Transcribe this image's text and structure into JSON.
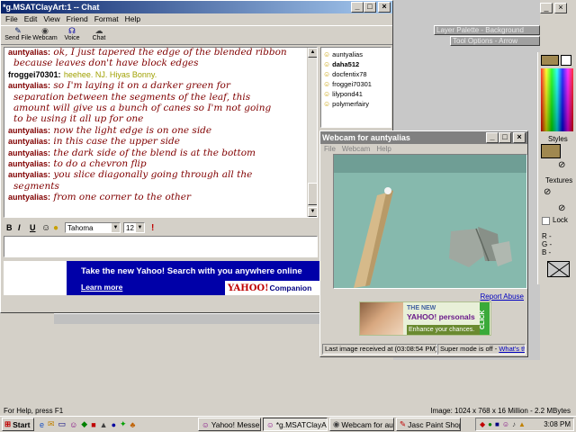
{
  "chat": {
    "title": "*g.MSATClayArt:1 -- Chat",
    "menu": [
      "File",
      "Edit",
      "View",
      "Friend",
      "Format",
      "Help"
    ],
    "toolbar": [
      "Send File",
      "Webcam",
      "Voice",
      "Chat"
    ],
    "messages": [
      {
        "nick": "auntyalias:",
        "text": "ok, I just tapered the edge of the blended ribbon"
      },
      {
        "nick": "",
        "text": "because leaves don't have block edges"
      },
      {
        "nick": "froggei70301:",
        "text": "heehee. NJ. Hiyas Bonny."
      },
      {
        "nick": "auntyalias:",
        "text": "so I'm laying it on a darker green for"
      },
      {
        "nick": "",
        "text": "separation between the segments of the leaf, this"
      },
      {
        "nick": "",
        "text": "amount will give us a bunch of canes so I'm not going"
      },
      {
        "nick": "",
        "text": "to be using it all up for one"
      },
      {
        "nick": "auntyalias:",
        "text": "now the light edge is on one side"
      },
      {
        "nick": "auntyalias:",
        "text": "in this case the upper side"
      },
      {
        "nick": "auntyalias:",
        "text": "the dark side of the blend is at the bottom"
      },
      {
        "nick": "auntyalias:",
        "text": "to do a chevron flip"
      },
      {
        "nick": "auntyalias:",
        "text": "you slice diagonally going through all the"
      },
      {
        "nick": "",
        "text": "segments"
      },
      {
        "nick": "auntyalias:",
        "text": "from one corner to the other"
      }
    ],
    "format": {
      "bold": "B",
      "italic": "I",
      "underline": "U",
      "font": "Tahoma",
      "size": "12"
    },
    "users": [
      "auntyalias",
      "daha512",
      "docfentix78",
      "froggei70301",
      "lilypond41",
      "polymerfairy"
    ],
    "ad": {
      "line1": "Take the new Yahoo! Search with you anywhere online",
      "learn": "Learn more",
      "brand": "YAHOO!",
      "brand2": "Companion"
    }
  },
  "webcam": {
    "title": "Webcam for auntyalias",
    "menu": [
      "File",
      "Webcam",
      "Help"
    ],
    "report": "Report Abuse",
    "ad": {
      "top": "THE NEW",
      "brand": "YAHOO! personals",
      "sub": "Enhance your chances.",
      "click": "CLICK"
    },
    "status": "Last image received at (03:08:54 PM)",
    "super": "Super mode is off -",
    "whats": "What's this?"
  },
  "psp": {
    "layer_palette": "Layer Palette - Background",
    "tool_options": "Tool Options - Arrow",
    "styles": "Styles",
    "textures": "Textures",
    "lock": "Lock",
    "r": "R -",
    "g": "G -",
    "b": "B -"
  },
  "statusbar": {
    "left": "For Help, press F1",
    "right": "Image:  1024 x 768 x 16 Million - 2.2 MBytes"
  },
  "taskbar": {
    "start": "Start",
    "tasks": [
      "Yahoo! Messenger",
      "*g.MSATClayA...",
      "Webcam for aunt...",
      "Jasc Paint Shop ..."
    ],
    "clock": "3:08 PM"
  },
  "colors": {
    "nick": "#800000",
    "accent": "#0a246a",
    "yahoo_blue": "#0000a8"
  }
}
